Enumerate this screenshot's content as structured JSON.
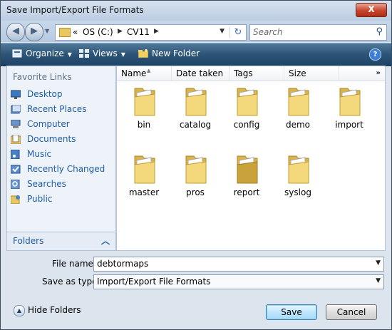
{
  "window": {
    "title": "Save Import/Export File Formats",
    "close_label": "X"
  },
  "address": {
    "recent_glyph": "«",
    "crumbs": [
      "OS (C:)",
      "CV11"
    ],
    "search_placeholder": "Search"
  },
  "toolbar": {
    "organize_label": "Organize",
    "views_label": "Views",
    "new_folder_label": "New Folder",
    "help_label": "?"
  },
  "nav": {
    "header": "Favorite Links",
    "items": [
      {
        "label": "Desktop",
        "icon": "desktop-icon"
      },
      {
        "label": "Recent Places",
        "icon": "recent-places-icon"
      },
      {
        "label": "Computer",
        "icon": "computer-icon"
      },
      {
        "label": "Documents",
        "icon": "documents-icon"
      },
      {
        "label": "Music",
        "icon": "music-icon"
      },
      {
        "label": "Recently Changed",
        "icon": "recently-changed-icon"
      },
      {
        "label": "Searches",
        "icon": "searches-icon"
      },
      {
        "label": "Public",
        "icon": "public-folder-icon"
      }
    ],
    "folders_label": "Folders"
  },
  "columns": {
    "name": "Name",
    "date": "Date taken",
    "tags": "Tags",
    "size": "Size",
    "more": "»"
  },
  "files": [
    {
      "name": "bin"
    },
    {
      "name": "catalog"
    },
    {
      "name": "config"
    },
    {
      "name": "demo"
    },
    {
      "name": "import"
    },
    {
      "name": "master"
    },
    {
      "name": "pros"
    },
    {
      "name": "report"
    },
    {
      "name": "syslog"
    }
  ],
  "form": {
    "file_name_label": "File name:",
    "file_name_value": "debtormaps",
    "save_type_label": "Save as type:",
    "save_type_value": "Import/Export File Formats"
  },
  "buttons": {
    "hide_folders": "Hide Folders",
    "save": "Save",
    "cancel": "Cancel"
  },
  "colors": {
    "toolbar": "#2c5476",
    "link": "#1f5ca8",
    "folder": "#e9c862"
  }
}
